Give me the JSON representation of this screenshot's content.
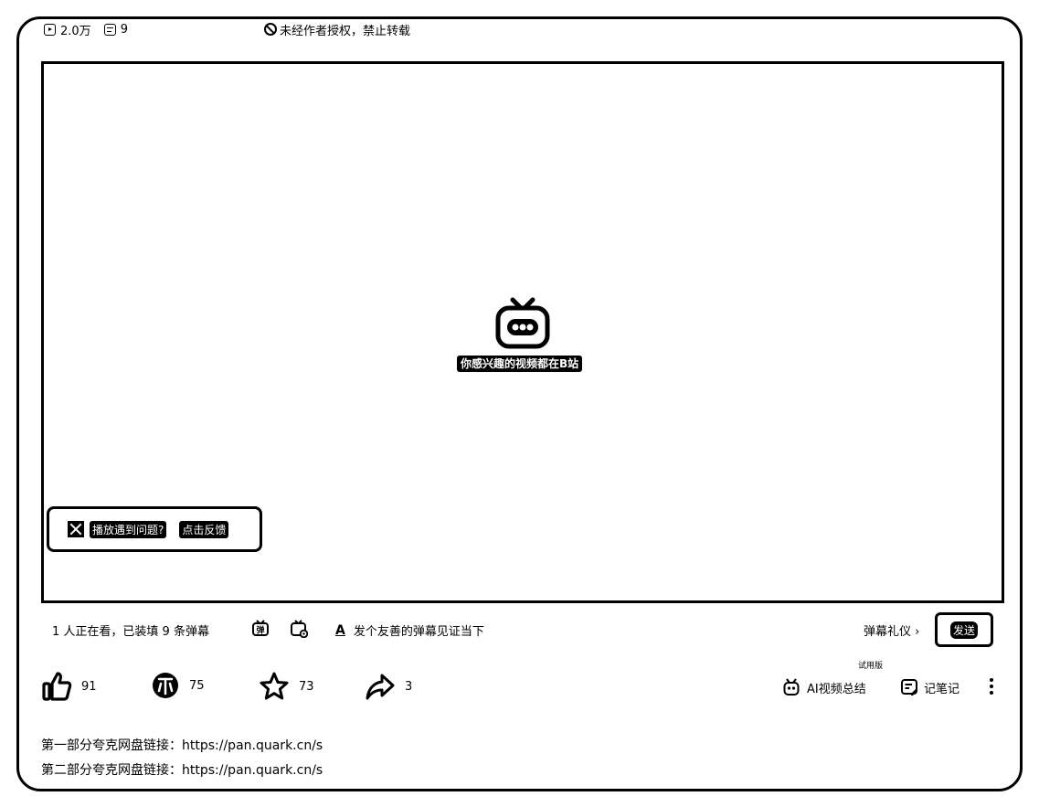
{
  "stats": {
    "views": "2.0万",
    "danmaku_count": "9",
    "copyright_notice": "未经作者授权，禁止转载"
  },
  "player": {
    "placeholder_caption": "你感兴趣的视频都在B站",
    "feedback": {
      "question": "播放遇到问题?",
      "link": "点击反馈"
    }
  },
  "danmaku_bar": {
    "viewing": "1 人正在看，已装填 9 条弹幕",
    "input_placeholder": "发个友善的弹幕见证当下",
    "etiquette": "弹幕礼仪 ›",
    "send_label": "发送"
  },
  "actions": {
    "like_count": "91",
    "coin_count": "75",
    "favorite_count": "73",
    "share_count": "3",
    "ai_trial_badge": "试用版",
    "ai_summary_label": "AI视频总结",
    "note_label": "记笔记"
  },
  "description": {
    "line1": "第一部分夸克网盘链接：https://pan.quark.cn/s",
    "line2": "第二部分夸克网盘链接：https://pan.quark.cn/s"
  },
  "icons": [
    "play-count-icon",
    "danmaku-count-icon",
    "no-repost-icon",
    "bilibili-tv-icon",
    "close-icon",
    "danmaku-toggle-icon",
    "danmaku-settings-icon",
    "text-style-icon",
    "like-icon",
    "coin-icon",
    "favorite-icon",
    "share-icon",
    "ai-robot-icon",
    "note-icon",
    "more-icon"
  ]
}
